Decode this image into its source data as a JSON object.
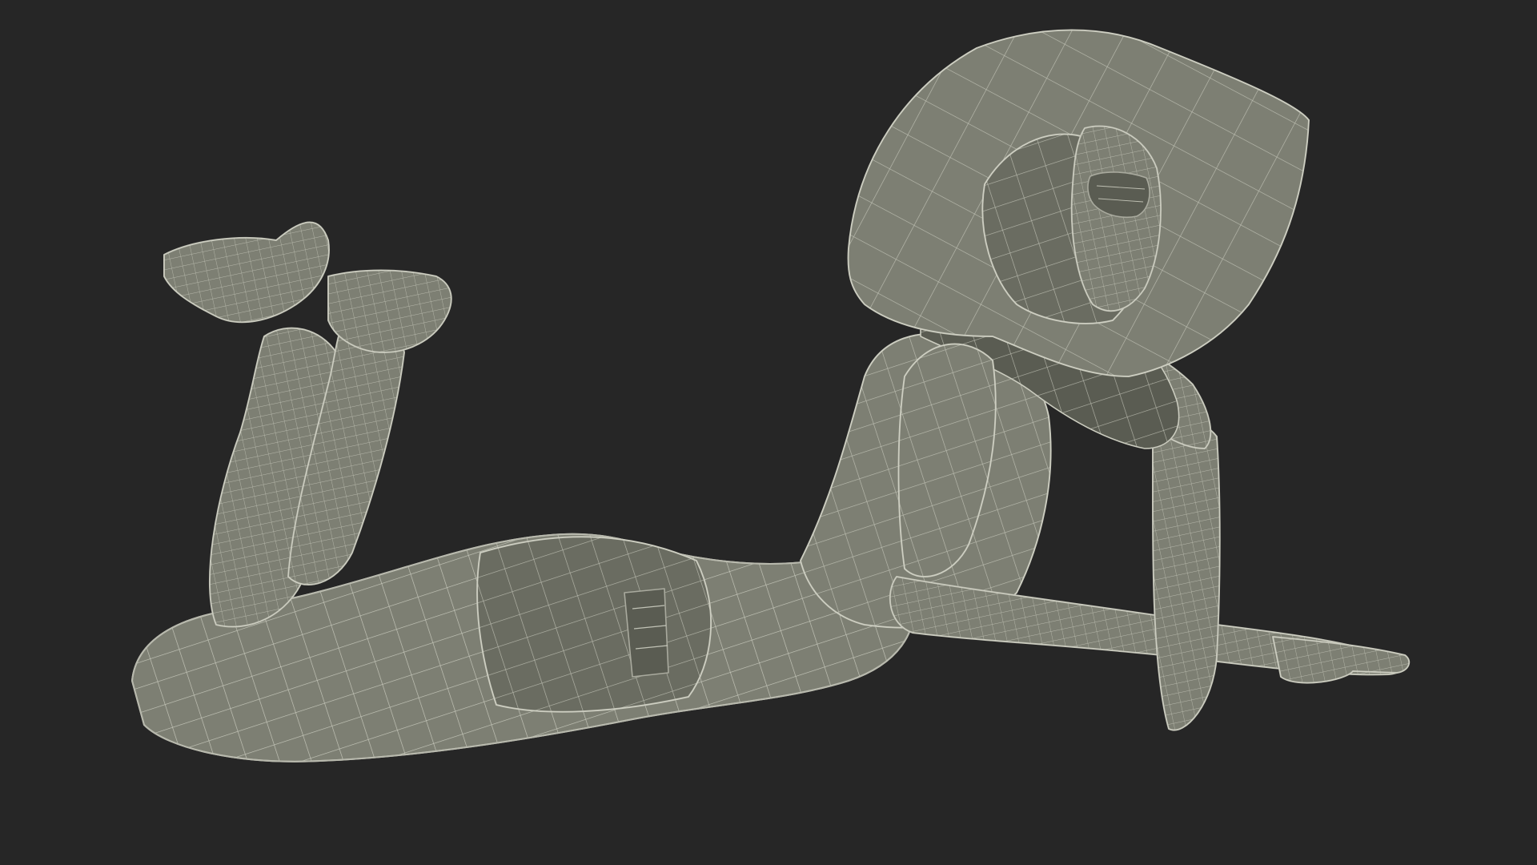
{
  "scene": {
    "background_color": "#262626",
    "mesh_color": "#7d7f73",
    "wire_color": "#d4d5c8"
  }
}
